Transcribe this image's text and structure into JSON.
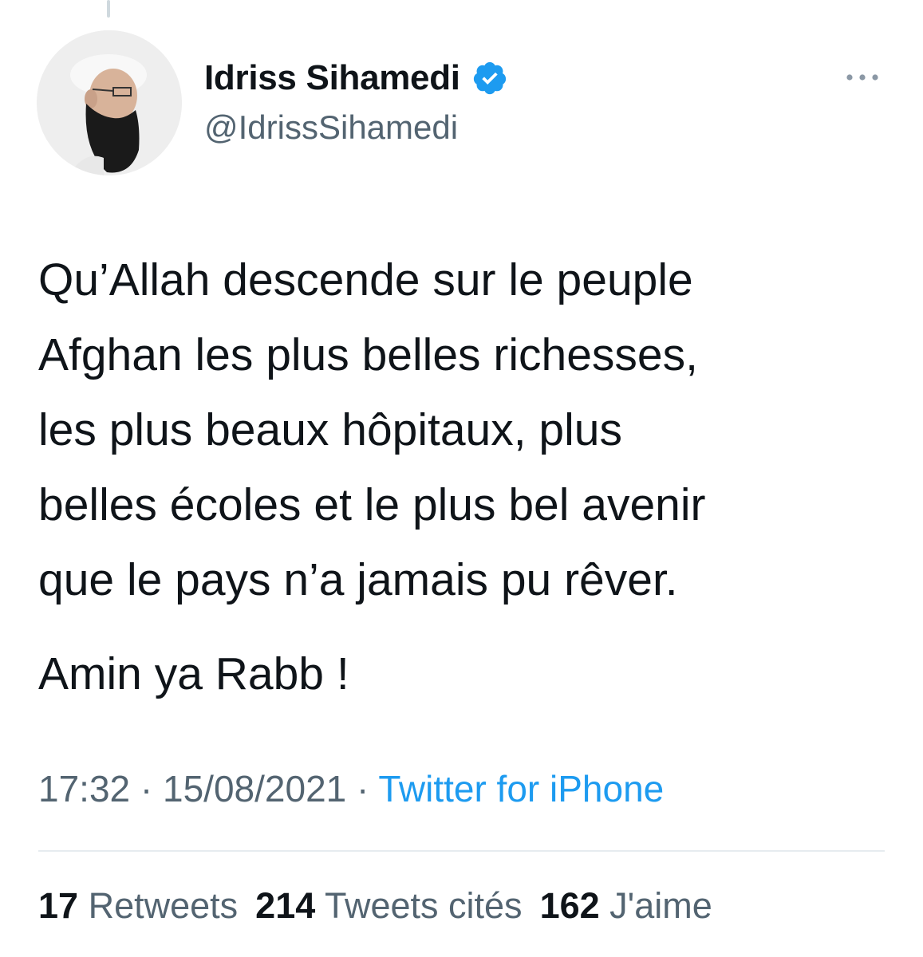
{
  "author": {
    "display_name": "Idriss Sihamedi",
    "handle": "@IdrissSihamedi",
    "verified_icon": "verified-badge-icon",
    "avatar": "profile-photo",
    "more_icon": "more-options-icon"
  },
  "tweet": {
    "text": "Qu’Allah descende sur le peuple\nAfghan les plus belles richesses,\nles plus beaux hôpitaux, plus\nbelles écoles et le plus bel avenir\nque le pays n’a jamais pu rêver.",
    "text_2": "Amin ya Rabb !",
    "time": "17:32",
    "separator": "·",
    "date": "15/08/2021",
    "source": "Twitter for iPhone"
  },
  "stats": {
    "retweets_count": "17",
    "retweets_label": "Retweets",
    "quotes_count": "214",
    "quotes_label": "Tweets cités",
    "likes_count": "162",
    "likes_label": "J'aime"
  },
  "colors": {
    "text": "#0f1419",
    "secondary": "#536471",
    "link": "#1d9bf0",
    "verified": "#1d9bf0"
  }
}
